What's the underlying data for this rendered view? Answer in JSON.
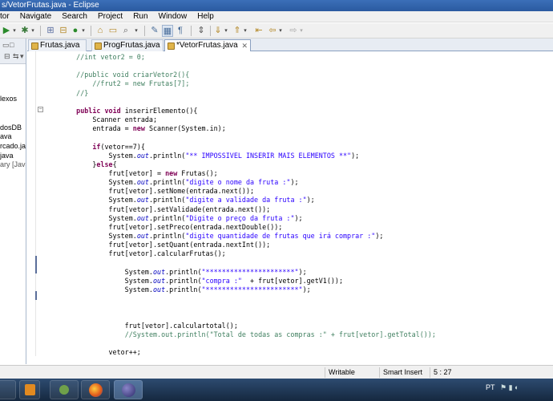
{
  "window": {
    "title": "s/VetorFrutas.java - Eclipse"
  },
  "menu": [
    "tor",
    "Navigate",
    "Search",
    "Project",
    "Run",
    "Window",
    "Help"
  ],
  "left_panel": {
    "items": [
      "lexos",
      "dosDB",
      "ava",
      "rcado.jav",
      "java",
      "ary [JavaS"
    ]
  },
  "tabs": [
    {
      "label": "Frutas.java",
      "active": false
    },
    {
      "label": "ProgFrutas.java",
      "active": false
    },
    {
      "label": "*VetorFrutas.java",
      "active": true,
      "close": "✕"
    }
  ],
  "code": {
    "lines": [
      "    //int vetor2 = 0;",
      "",
      "    //public void criarVetor2(){",
      "        //frut2 = new Frutas[7];",
      "    //}",
      "",
      "    public void inserirElemento(){",
      "        Scanner entrada;",
      "        entrada = new Scanner(System.in);",
      "",
      "        if(vetor==7){",
      "            System.out.println(\"** IMPOSSIVEL INSERIR MAIS ELEMENTOS **\");",
      "        }else{",
      "            frut[vetor] = new Frutas();",
      "            System.out.println(\"digite o nome da fruta :\");",
      "            frut[vetor].setNome(entrada.next());",
      "            System.out.println(\"digite a validade da fruta :\");",
      "            frut[vetor].setValidade(entrada.next());",
      "            System.out.println(\"Digite o preço da fruta :\");",
      "            frut[vetor].setPreco(entrada.nextDouble());",
      "            System.out.println(\"digite quantidade de frutas que irá comprar :\");",
      "            frut[vetor].setQuant(entrada.nextInt());",
      "            frut[vetor].calcularFrutas();",
      "",
      "                System.out.println(\"**********************\");",
      "                System.out.println(\"compra :\"  + frut[vetor].getV1());",
      "                System.out.println(\"***********************\");",
      "",
      "",
      "",
      "                frut[vetor].calculartotal();",
      "                //System.out.println(\"Total de todas as compras :\" + frut[vetor].getTotal());",
      "",
      "            vetor++;"
    ]
  },
  "status": {
    "mode": "Writable",
    "insert": "Smart Insert",
    "position": "5 : 27"
  },
  "tray": {
    "lang": "PT"
  },
  "colors": {
    "keyword": "#7f0055",
    "comment": "#3f7f5f",
    "string": "#2a00ff",
    "field": "#0000c0"
  }
}
